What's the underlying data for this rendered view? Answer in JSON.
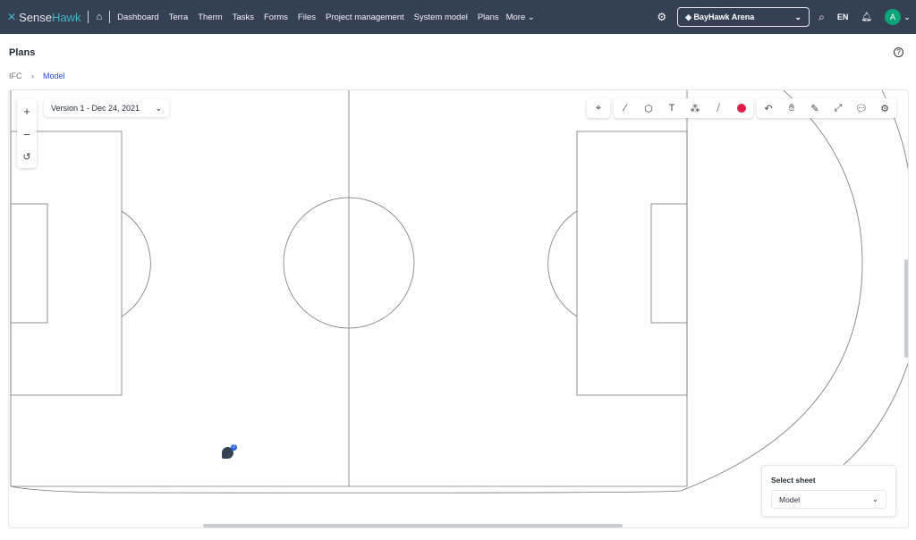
{
  "nav": {
    "brand_a": "Sense",
    "brand_b": "Hawk",
    "items": [
      "Dashboard",
      "Terra",
      "Therm",
      "Tasks",
      "Forms",
      "Files",
      "Project management",
      "System model",
      "Plans"
    ],
    "more": "More",
    "project": "BayHawk Arena",
    "lang": "EN",
    "avatar": "A"
  },
  "page": {
    "title": "Plans",
    "breadcrumb": [
      "IFC",
      "Model"
    ]
  },
  "viewer": {
    "version": "Version 1 - Dec 24, 2021",
    "annotation_count": "2",
    "color_swatch": "#e11d48",
    "toolbar_left": [
      "location-pin-icon"
    ],
    "toolbar_mid": [
      "line-icon",
      "polygon-icon",
      "text-icon",
      "magic-wand-icon",
      "ruler-icon",
      "color-swatch"
    ],
    "toolbar_right": [
      "undo-icon",
      "hand-icon",
      "pencil-icon",
      "expand-icon",
      "comment-icon",
      "settings-icon"
    ],
    "sheet_label": "Select sheet",
    "sheet_value": "Model"
  }
}
